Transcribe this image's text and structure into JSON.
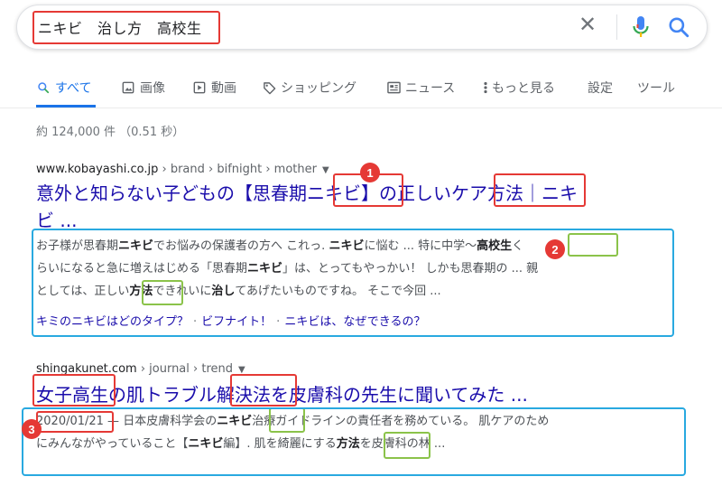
{
  "search": {
    "query": "ニキビ　治し方　高校生"
  },
  "tabs": [
    {
      "label": "すべて",
      "icon": "search-icon",
      "active": true
    },
    {
      "label": "画像",
      "icon": "image-icon"
    },
    {
      "label": "動画",
      "icon": "video-icon"
    },
    {
      "label": "ショッピング",
      "icon": "tag-icon"
    },
    {
      "label": "ニュース",
      "icon": "news-icon"
    },
    {
      "label": "もっと見る",
      "icon": "more-vert-icon"
    },
    {
      "label": "設定"
    },
    {
      "label": "ツール"
    }
  ],
  "stats": "約 124,000 件 （0.51 秒）",
  "results": [
    {
      "cite_domain": "www.kobayashi.co.jp",
      "cite_path": " › brand › bifnight › mother",
      "title_line1": "意外と知らない子どもの【思春期ニキビ】の正しいケア方法｜ニキ",
      "title_line2": "ビ ...",
      "snippet": [
        {
          "t": "お子様が思春期"
        },
        {
          "b": "ニキビ"
        },
        {
          "t": "でお悩みの保護者の方へ これっ. "
        },
        {
          "b": "ニキビ"
        },
        {
          "t": "に悩む ... 特に中学～"
        },
        {
          "b": "高校生"
        },
        {
          "t": "く"
        },
        {
          "br": true
        },
        {
          "t": "らいになると急に増えはじめる「思春期"
        },
        {
          "b": "ニキビ"
        },
        {
          "t": "」は、とってもやっかい！ しかも思春期の ... 親"
        },
        {
          "br": true
        },
        {
          "t": "としては、正しい"
        },
        {
          "b": "方法"
        },
        {
          "t": "できれいに"
        },
        {
          "b": "治し"
        },
        {
          "t": "てあげたいものですね。 そこで今回 ..."
        }
      ],
      "sitelinks": [
        "キミのニキビはどのタイプ？",
        "ビフナイト！",
        "ニキビは、なぜできるの？"
      ]
    },
    {
      "cite_domain": "shingakunet.com",
      "cite_path": " › journal › trend",
      "title_line1": "女子高生の肌トラブル解決法を皮膚科の先生に聞いてみた ...",
      "snippet": [
        {
          "t": "2020/01/21 — 日本皮膚科学会の"
        },
        {
          "b": "ニキビ"
        },
        {
          "t": "治療ガイドラインの責任者を務めている。 肌ケアのため"
        },
        {
          "br": true
        },
        {
          "t": "にみんながやっていること【"
        },
        {
          "b": "ニキビ"
        },
        {
          "t": "編】. 肌を綺麗にする"
        },
        {
          "b": "方法"
        },
        {
          "t": "を皮膚科の林 ..."
        }
      ]
    }
  ],
  "annotations": {
    "badges": [
      "1",
      "2",
      "3"
    ]
  },
  "colors": {
    "link": "#1a0dab",
    "accent": "#1a73e8",
    "annotation_red": "#e53935",
    "annotation_green": "#8bc34a",
    "annotation_blue": "#29a9e0"
  }
}
